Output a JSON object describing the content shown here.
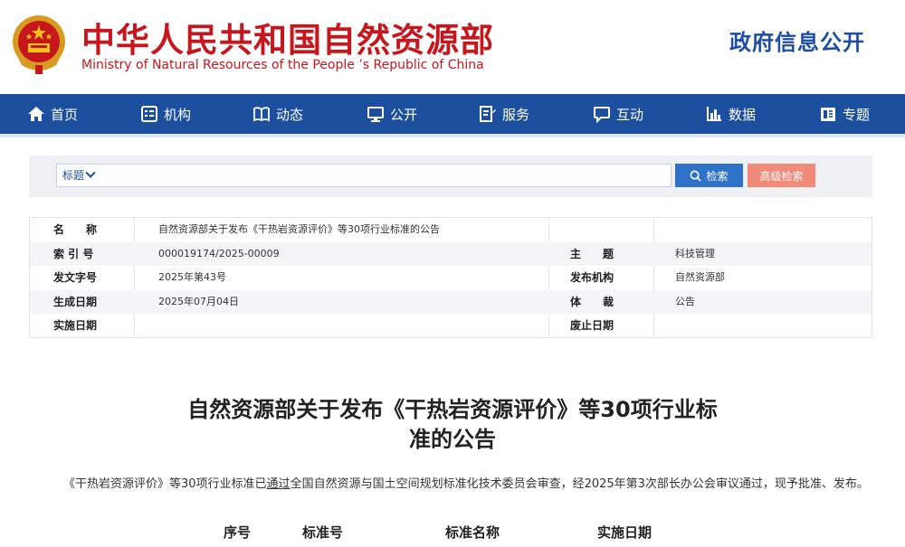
{
  "header": {
    "title_cn": "中华人民共和国自然资源部",
    "title_en": "Ministry of Natural Resources of the People ’s Republic of China",
    "gov_info": "政府信息公开"
  },
  "nav": {
    "items": [
      {
        "label": "首页",
        "icon": "home-icon"
      },
      {
        "label": "机构",
        "icon": "organization-icon"
      },
      {
        "label": "动态",
        "icon": "book-icon"
      },
      {
        "label": "公开",
        "icon": "monitor-icon"
      },
      {
        "label": "服务",
        "icon": "edit-document-icon"
      },
      {
        "label": "互动",
        "icon": "chat-icon"
      },
      {
        "label": "数据",
        "icon": "bar-chart-icon"
      },
      {
        "label": "专题",
        "icon": "folder-icon"
      }
    ]
  },
  "search": {
    "select_label": "标题",
    "placeholder": "",
    "search_button": "检索",
    "advanced_button": "高级检索"
  },
  "info": {
    "name_label": "名　　称",
    "name_value": "自然资源部关于发布《干热岩资源评价》等30项行业标准的公告",
    "index_label": "索 引 号",
    "index_value": "000019174/2025-00009",
    "topic_label": "主　　题",
    "topic_value": "科技管理",
    "doc_no_label": "发文字号",
    "doc_no_value": "2025年第43号",
    "issuer_label": "发布机构",
    "issuer_value": "自然资源部",
    "date_label": "生成日期",
    "date_value": "2025年07月04日",
    "genre_label": "体　　裁",
    "genre_value": "公告",
    "effective_label": "实施日期",
    "effective_value": "",
    "repeal_label": "废止日期",
    "repeal_value": ""
  },
  "article": {
    "title_line1": "自然资源部关于发布《干热岩资源评价》等30项行业标",
    "title_line2": "准的公告",
    "body_part1": "《干热岩资源评价》等30项行业标准已",
    "body_part2": "通过",
    "body_part3": "全国自然资源与国土空间规划标准化技术委员会审查，经2025年第3次部长办公会审议通过，现予批准、发布。"
  },
  "table": {
    "headers": [
      "序号",
      "标准号",
      "标准名称",
      "实施日期"
    ]
  },
  "colors": {
    "brand_red": "#c8161d",
    "nav_blue": "#1d4f9f",
    "search_blue": "#2f73c9",
    "advanced_salmon": "#f28a7a"
  }
}
